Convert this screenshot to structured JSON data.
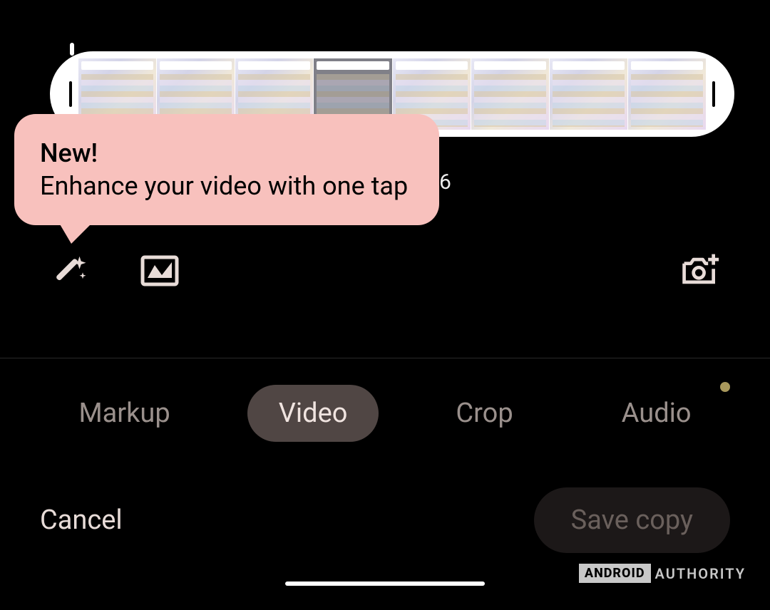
{
  "tooltip": {
    "title": "New!",
    "body": "Enhance your video with one tap"
  },
  "timestamp_visible_fragment": "6",
  "toolbar": {
    "enhance_icon": "magic-wand-icon",
    "frame_icon": "frame-icon",
    "export_frame_icon": "camera-plus-icon"
  },
  "tabs": {
    "items": [
      {
        "label": "Markup",
        "active": false,
        "has_dot": false
      },
      {
        "label": "Video",
        "active": true,
        "has_dot": false
      },
      {
        "label": "Crop",
        "active": false,
        "has_dot": false
      },
      {
        "label": "Audio",
        "active": false,
        "has_dot": true
      }
    ]
  },
  "actions": {
    "cancel": "Cancel",
    "save": "Save copy"
  },
  "watermark": {
    "box": "ANDROID",
    "text": "AUTHORITY"
  }
}
